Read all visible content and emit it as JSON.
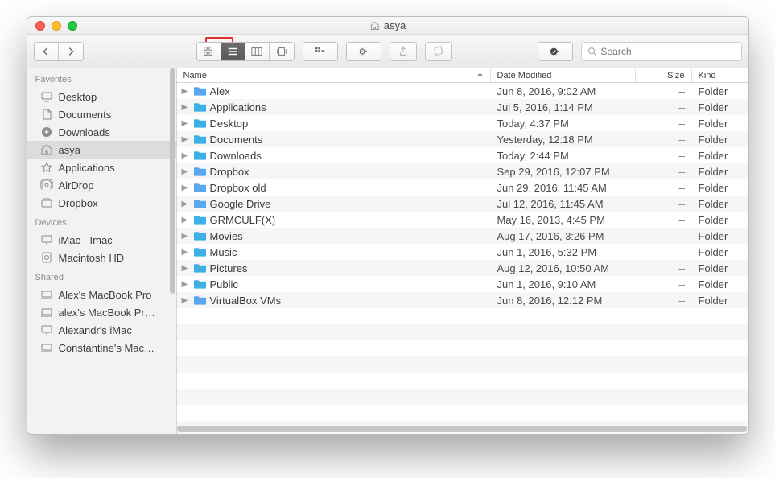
{
  "window": {
    "title": "asya"
  },
  "search": {
    "placeholder": "Search"
  },
  "sidebar": {
    "sections": [
      {
        "heading": "Favorites",
        "items": [
          {
            "label": "Desktop",
            "icon": "desktop"
          },
          {
            "label": "Documents",
            "icon": "documents"
          },
          {
            "label": "Downloads",
            "icon": "downloads"
          },
          {
            "label": "asya",
            "icon": "home",
            "selected": true
          },
          {
            "label": "Applications",
            "icon": "applications"
          },
          {
            "label": "AirDrop",
            "icon": "airdrop"
          },
          {
            "label": "Dropbox",
            "icon": "dropbox"
          }
        ]
      },
      {
        "heading": "Devices",
        "items": [
          {
            "label": "iMac - Imac",
            "icon": "imac"
          },
          {
            "label": "Macintosh HD",
            "icon": "disk"
          }
        ]
      },
      {
        "heading": "Shared",
        "items": [
          {
            "label": "Alex's MacBook Pro",
            "icon": "computer"
          },
          {
            "label": "alex's MacBook Pr…",
            "icon": "computer"
          },
          {
            "label": "Alexandr's iMac",
            "icon": "imac"
          },
          {
            "label": "Constantine's Mac…",
            "icon": "computer"
          }
        ]
      }
    ]
  },
  "columns": {
    "name": "Name",
    "date": "Date Modified",
    "size": "Size",
    "kind": "Kind"
  },
  "files": [
    {
      "name": "Alex",
      "color": "#58a7ef",
      "date": "Jun 8, 2016, 9:02 AM",
      "size": "--",
      "kind": "Folder"
    },
    {
      "name": "Applications",
      "color": "#3fb0e6",
      "date": "Jul 5, 2016, 1:14 PM",
      "size": "--",
      "kind": "Folder"
    },
    {
      "name": "Desktop",
      "color": "#3fb0e6",
      "date": "Today, 4:37 PM",
      "size": "--",
      "kind": "Folder"
    },
    {
      "name": "Documents",
      "color": "#3fb0e6",
      "date": "Yesterday, 12:18 PM",
      "size": "--",
      "kind": "Folder"
    },
    {
      "name": "Downloads",
      "color": "#3fb0e6",
      "date": "Today, 2:44 PM",
      "size": "--",
      "kind": "Folder"
    },
    {
      "name": "Dropbox",
      "color": "#58a7ef",
      "date": "Sep 29, 2016, 12:07 PM",
      "size": "--",
      "kind": "Folder"
    },
    {
      "name": "Dropbox old",
      "color": "#58a7ef",
      "date": "Jun 29, 2016, 11:45 AM",
      "size": "--",
      "kind": "Folder"
    },
    {
      "name": "Google Drive",
      "color": "#58a7ef",
      "date": "Jul 12, 2016, 11:45 AM",
      "size": "--",
      "kind": "Folder"
    },
    {
      "name": "GRMCULF(X)",
      "color": "#3fb0e6",
      "date": "May 16, 2013, 4:45 PM",
      "size": "--",
      "kind": "Folder"
    },
    {
      "name": "Movies",
      "color": "#3fb0e6",
      "date": "Aug 17, 2016, 3:26 PM",
      "size": "--",
      "kind": "Folder"
    },
    {
      "name": "Music",
      "color": "#3fb0e6",
      "date": "Jun 1, 2016, 5:32 PM",
      "size": "--",
      "kind": "Folder"
    },
    {
      "name": "Pictures",
      "color": "#3fb0e6",
      "date": "Aug 12, 2016, 10:50 AM",
      "size": "--",
      "kind": "Folder"
    },
    {
      "name": "Public",
      "color": "#3fb0e6",
      "date": "Jun 1, 2016, 9:10 AM",
      "size": "--",
      "kind": "Folder"
    },
    {
      "name": "VirtualBox VMs",
      "color": "#58a7ef",
      "date": "Jun 8, 2016, 12:12 PM",
      "size": "--",
      "kind": "Folder"
    }
  ]
}
